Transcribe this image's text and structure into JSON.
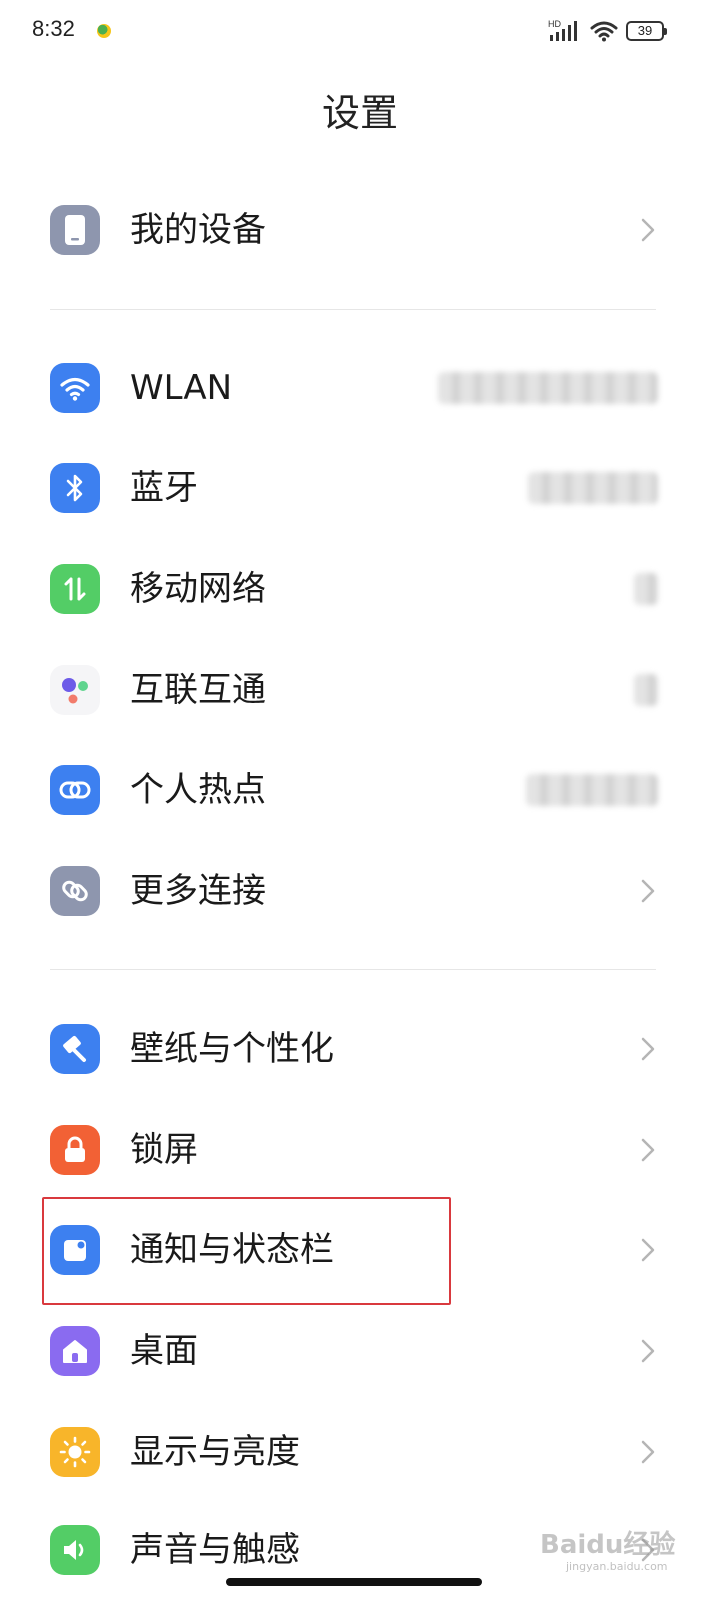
{
  "status_bar": {
    "time": "8:32",
    "network_label": "HD",
    "battery": "39"
  },
  "header": {
    "title": "设置"
  },
  "groups": {
    "device": [
      {
        "label": "我的设备",
        "icon": "phone-icon",
        "color": "#8e96ae"
      }
    ],
    "connections": [
      {
        "label": "WLAN",
        "icon": "wifi-icon",
        "color": "#3d80f0",
        "value": "(blurred)"
      },
      {
        "label": "蓝牙",
        "icon": "bluetooth-icon",
        "color": "#3d80f0",
        "value": "(blurred)"
      },
      {
        "label": "移动网络",
        "icon": "mobile-data-icon",
        "color": "#53cd66",
        "value": "(blurred)"
      },
      {
        "label": "互联互通",
        "icon": "interconnect-icon",
        "color": "#f5f5f7"
      },
      {
        "label": "个人热点",
        "icon": "hotspot-icon",
        "color": "#3d80f0",
        "value": "(blurred)"
      },
      {
        "label": "更多连接",
        "icon": "link-icon",
        "color": "#8e96ae"
      }
    ],
    "personalization": [
      {
        "label": "壁纸与个性化",
        "icon": "wallpaper-icon",
        "color": "#3d80f0"
      },
      {
        "label": "锁屏",
        "icon": "lock-icon",
        "color": "#f26135"
      },
      {
        "label": "通知与状态栏",
        "icon": "notification-icon",
        "color": "#3d80f0"
      },
      {
        "label": "桌面",
        "icon": "home-icon",
        "color": "#8a6bf0"
      },
      {
        "label": "显示与亮度",
        "icon": "brightness-icon",
        "color": "#f8b52a"
      },
      {
        "label": "声音与触感",
        "icon": "sound-icon",
        "color": "#53cd66"
      }
    ]
  },
  "watermark": {
    "text": "Baidu经验",
    "sub": "jingyan.baidu.com"
  }
}
